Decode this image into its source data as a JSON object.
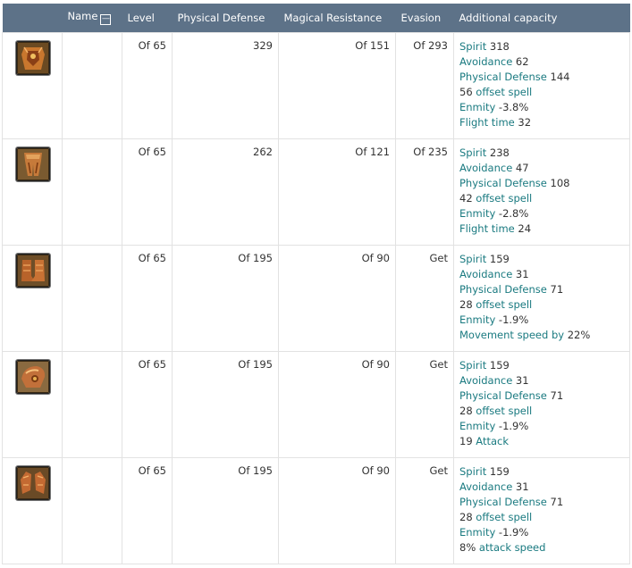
{
  "headers": {
    "icon": "",
    "name": "Name",
    "level": "Level",
    "physical_defense": "Physical Defense",
    "magical_resistance": "Magical Resistance",
    "evasion": "Evasion",
    "additional": "Additional capacity",
    "sort_glyph": "—"
  },
  "rows": [
    {
      "icon": "armor-breastplate-icon",
      "name": "",
      "level": "Of 65",
      "physical_defense": "329",
      "magical_resistance": "Of 151",
      "evasion": "Of 293",
      "capacity": [
        {
          "pre": "",
          "hl": "Spirit",
          "post": " 318"
        },
        {
          "pre": "",
          "hl": "Avoidance",
          "post": " 62"
        },
        {
          "pre": "",
          "hl": "Physical Defense",
          "post": " 144"
        },
        {
          "pre": "56 ",
          "hl": "offset spell",
          "post": ""
        },
        {
          "pre": "",
          "hl": "Enmity",
          "post": " -3.8%"
        },
        {
          "pre": "",
          "hl": "Flight time",
          "post": " 32"
        }
      ]
    },
    {
      "icon": "armor-leggings-icon",
      "name": "",
      "level": "Of 65",
      "physical_defense": "262",
      "magical_resistance": "Of 121",
      "evasion": "Of 235",
      "capacity": [
        {
          "pre": "",
          "hl": "Spirit",
          "post": " 238"
        },
        {
          "pre": "",
          "hl": "Avoidance",
          "post": " 47"
        },
        {
          "pre": "",
          "hl": "Physical Defense",
          "post": " 108"
        },
        {
          "pre": "42 ",
          "hl": "offset spell",
          "post": ""
        },
        {
          "pre": "",
          "hl": "Enmity",
          "post": " -2.8%"
        },
        {
          "pre": "",
          "hl": "Flight time",
          "post": " 24"
        }
      ]
    },
    {
      "icon": "armor-boots-icon",
      "name": "",
      "level": "Of 65",
      "physical_defense": "Of 195",
      "magical_resistance": "Of 90",
      "evasion": "Get",
      "capacity": [
        {
          "pre": "",
          "hl": "Spirit",
          "post": " 159"
        },
        {
          "pre": "",
          "hl": "Avoidance",
          "post": " 31"
        },
        {
          "pre": "",
          "hl": "Physical Defense",
          "post": " 71"
        },
        {
          "pre": "28 ",
          "hl": "offset spell",
          "post": ""
        },
        {
          "pre": "",
          "hl": "Enmity",
          "post": " -1.9%"
        },
        {
          "pre": "",
          "hl": "Movement speed by",
          "post": " 22%"
        }
      ]
    },
    {
      "icon": "armor-shoulder-icon",
      "name": "",
      "level": "Of 65",
      "physical_defense": "Of 195",
      "magical_resistance": "Of 90",
      "evasion": "Get",
      "capacity": [
        {
          "pre": "",
          "hl": "Spirit",
          "post": " 159"
        },
        {
          "pre": "",
          "hl": "Avoidance",
          "post": " 31"
        },
        {
          "pre": "",
          "hl": "Physical Defense",
          "post": " 71"
        },
        {
          "pre": "28 ",
          "hl": "offset spell",
          "post": ""
        },
        {
          "pre": "",
          "hl": "Enmity",
          "post": " -1.9%"
        },
        {
          "pre": "19 ",
          "hl": "Attack",
          "post": ""
        }
      ]
    },
    {
      "icon": "armor-gloves-icon",
      "name": "",
      "level": "Of 65",
      "physical_defense": "Of 195",
      "magical_resistance": "Of 90",
      "evasion": "Get",
      "capacity": [
        {
          "pre": "",
          "hl": "Spirit",
          "post": " 159"
        },
        {
          "pre": "",
          "hl": "Avoidance",
          "post": " 31"
        },
        {
          "pre": "",
          "hl": "Physical Defense",
          "post": " 71"
        },
        {
          "pre": "28 ",
          "hl": "offset spell",
          "post": ""
        },
        {
          "pre": "",
          "hl": "Enmity",
          "post": " -1.9%"
        },
        {
          "pre": "8% ",
          "hl": "attack speed",
          "post": ""
        }
      ]
    }
  ]
}
